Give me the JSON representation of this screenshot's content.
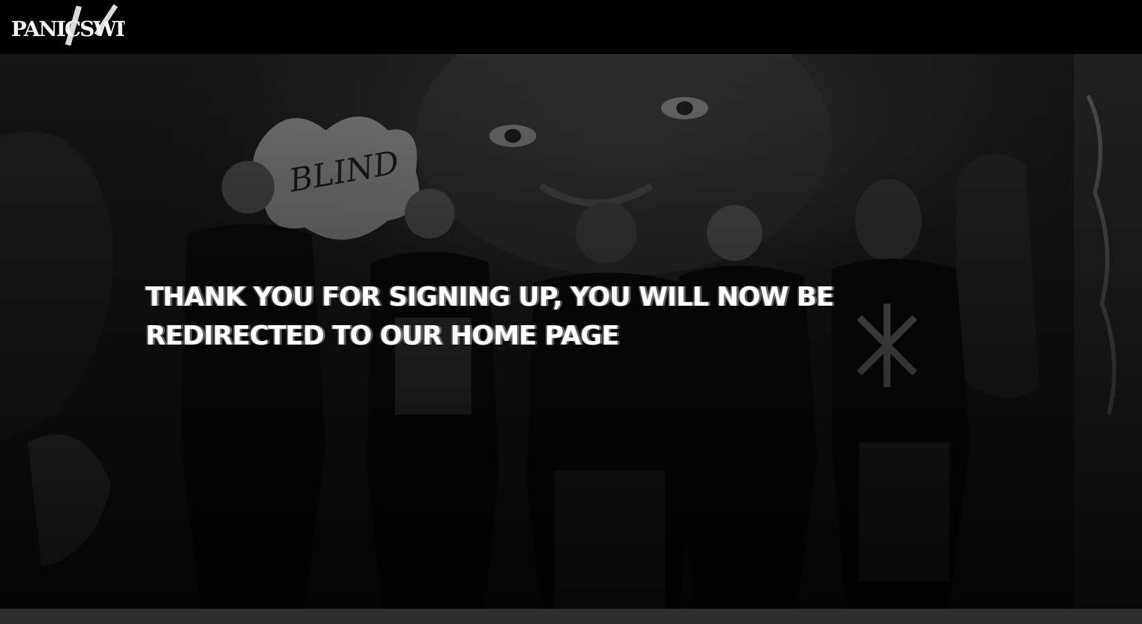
{
  "header": {
    "logo_text": "PANICSWITCH"
  },
  "hero": {
    "message": "THANK YOU FOR SIGNING UP, YOU WILL NOW BE REDIRECTED TO OUR HOME PAGE"
  },
  "colors": {
    "background": "#000000",
    "text": "#ffffff",
    "footer": "#2e2e2e"
  }
}
